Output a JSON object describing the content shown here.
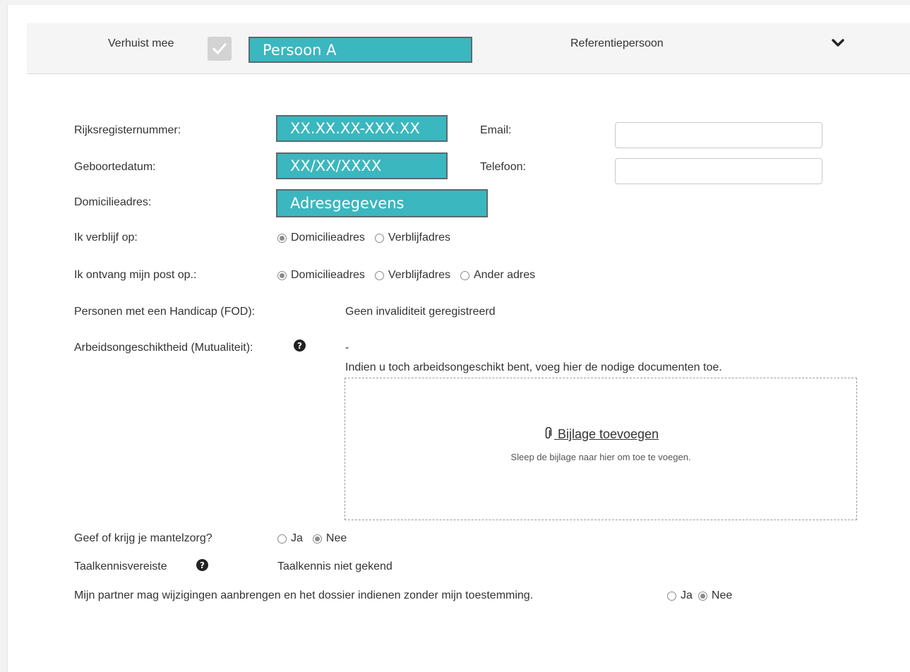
{
  "header": {
    "moves_along_label": "Verhuist mee",
    "person_name": "Persoon A",
    "role": "Referentiepersoon",
    "expand_icon": "chevron-down-icon"
  },
  "form": {
    "national_number": {
      "label": "Rijksregisternummer:",
      "value": "XX.XX.XX-XXX.XX"
    },
    "birth_date": {
      "label": "Geboortedatum:",
      "value": "XX/XX/XXXX"
    },
    "domicile_address": {
      "label": "Domicilieadres:",
      "value": "Adresgegevens"
    },
    "email": {
      "label": "Email:",
      "value": ""
    },
    "phone": {
      "label": "Telefoon:",
      "value": ""
    },
    "stay_at": {
      "label": "Ik verblijf op:",
      "options": [
        "Domicilieadres",
        "Verblijfadres"
      ],
      "selected": "Domicilieadres"
    },
    "mail_at": {
      "label": "Ik ontvang mijn post op.:",
      "options": [
        "Domicilieadres",
        "Verblijfadres",
        "Ander adres"
      ],
      "selected": "Domicilieadres"
    },
    "handicap": {
      "label": "Personen met een Handicap (FOD):",
      "value": "Geen invaliditeit geregistreerd"
    },
    "incapacity": {
      "label": "Arbeidsongeschiktheid (Mutualiteit):",
      "value": "-",
      "instruction": "Indien u toch arbeidsongeschikt bent, voeg hier de nodige documenten toe.",
      "attach_label": " Bijlage toevoegen",
      "attach_hint": "Sleep de bijlage naar hier om toe te voegen."
    },
    "care": {
      "label": "Geef of krijg je mantelzorg?",
      "options": [
        "Ja",
        "Nee"
      ],
      "selected": "Nee"
    },
    "language": {
      "label": "Taalkennisvereiste",
      "value": "Taalkennis niet gekend"
    },
    "partner_permission": {
      "label": "Mijn partner mag wijzigingen aanbrengen en het dossier indienen zonder mijn toestemming.",
      "options": [
        "Ja",
        "Nee"
      ],
      "selected": "Nee"
    }
  }
}
